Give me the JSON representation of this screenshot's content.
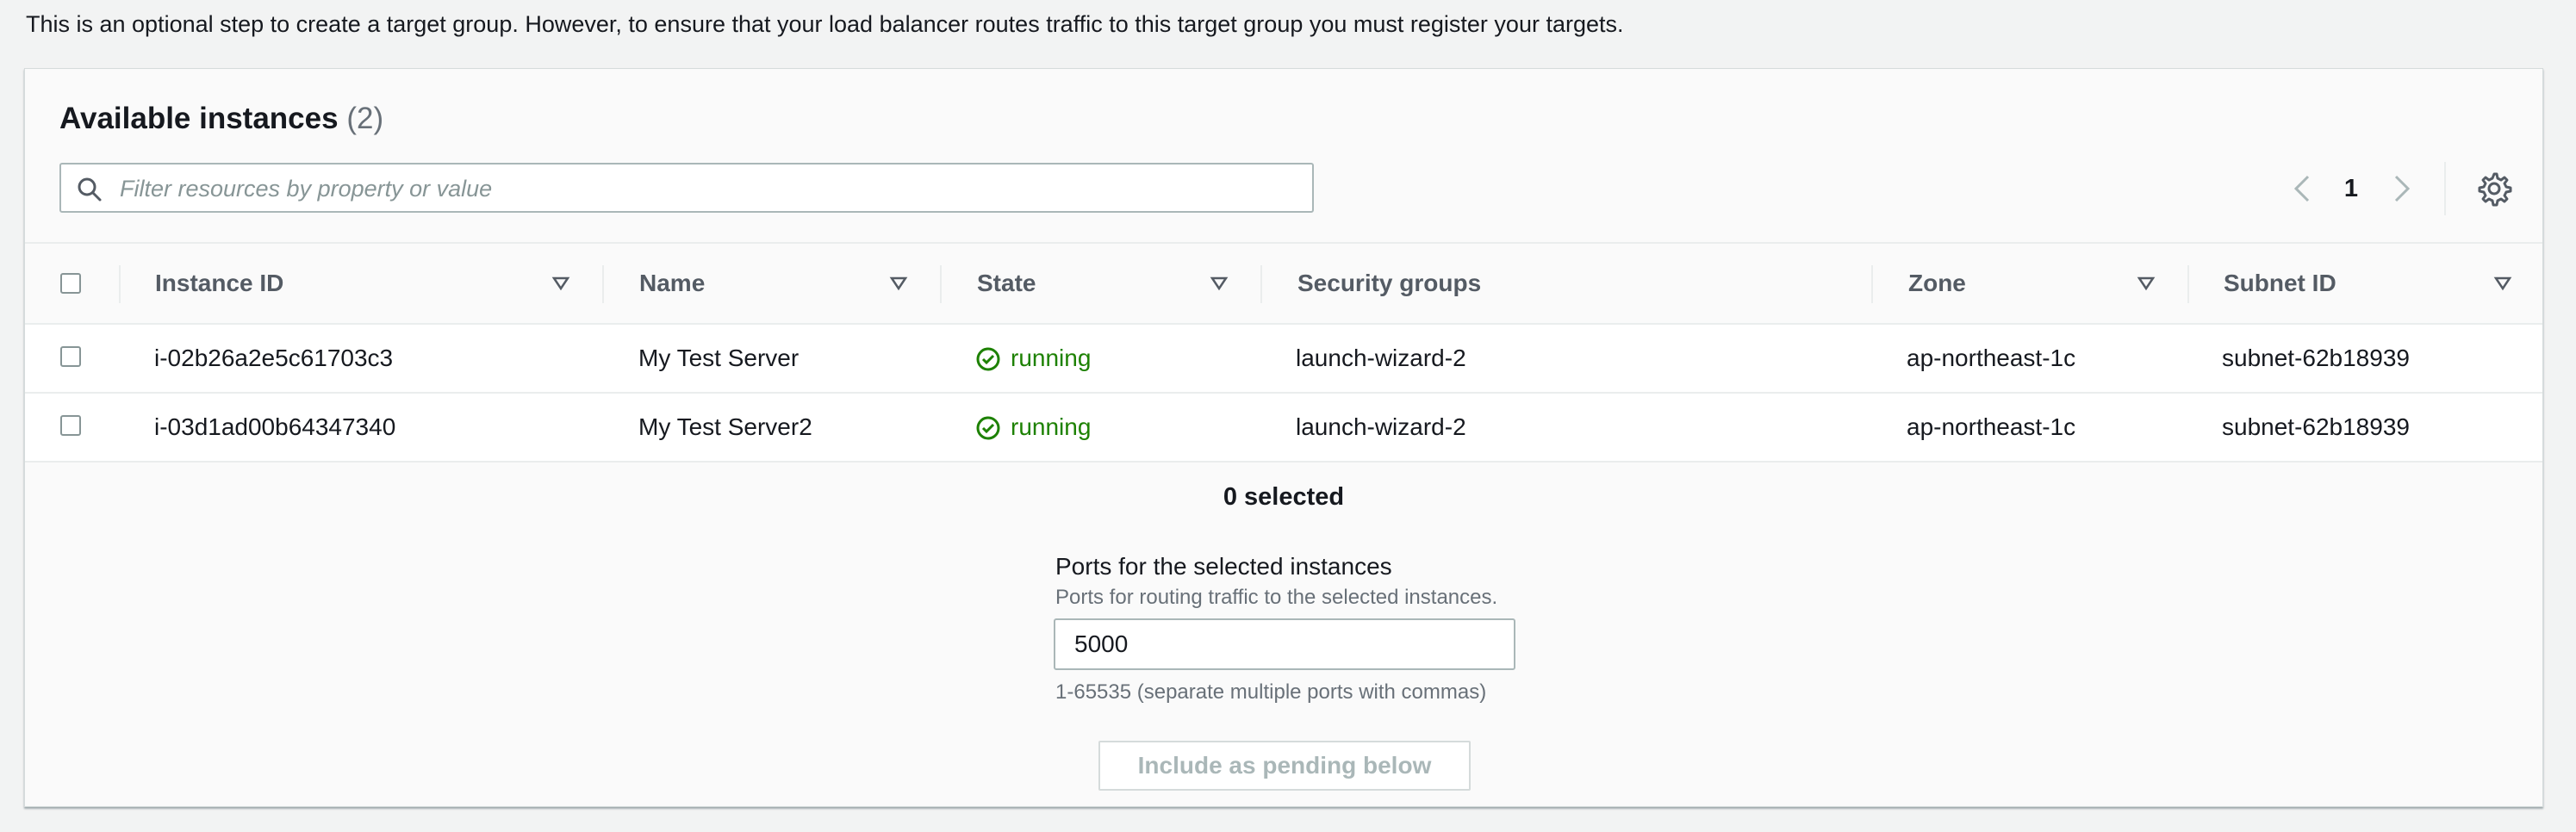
{
  "intro_text": "This is an optional step to create a target group. However, to ensure that your load balancer routes traffic to this target group you must register your targets.",
  "panel": {
    "title": "Available instances",
    "count": "(2)"
  },
  "filter": {
    "placeholder": "Filter resources by property or value",
    "icon": "search-icon"
  },
  "pagination": {
    "current_page": "1",
    "prev_icon": "chevron-left-icon",
    "next_icon": "chevron-right-icon"
  },
  "settings_icon": "gear-icon",
  "table": {
    "columns": [
      "Instance ID",
      "Name",
      "State",
      "Security groups",
      "Zone",
      "Subnet ID"
    ],
    "rows": [
      {
        "instance_id": "i-02b26a2e5c61703c3",
        "name": "My Test Server",
        "state": "running",
        "security_groups": "launch-wizard-2",
        "zone": "ap-northeast-1c",
        "subnet_id": "subnet-62b18939"
      },
      {
        "instance_id": "i-03d1ad00b64347340",
        "name": "My Test Server2",
        "state": "running",
        "security_groups": "launch-wizard-2",
        "zone": "ap-northeast-1c",
        "subnet_id": "subnet-62b18939"
      }
    ]
  },
  "selection": {
    "count_text": "0 selected"
  },
  "ports": {
    "label": "Ports for the selected instances",
    "description": "Ports for routing traffic to the selected instances.",
    "value": "5000",
    "hint": "1-65535 (separate multiple ports with commas)"
  },
  "include_button": "Include as pending below",
  "colors": {
    "running": "#1d8102",
    "border": "#aab7b8",
    "muted": "#687078"
  }
}
